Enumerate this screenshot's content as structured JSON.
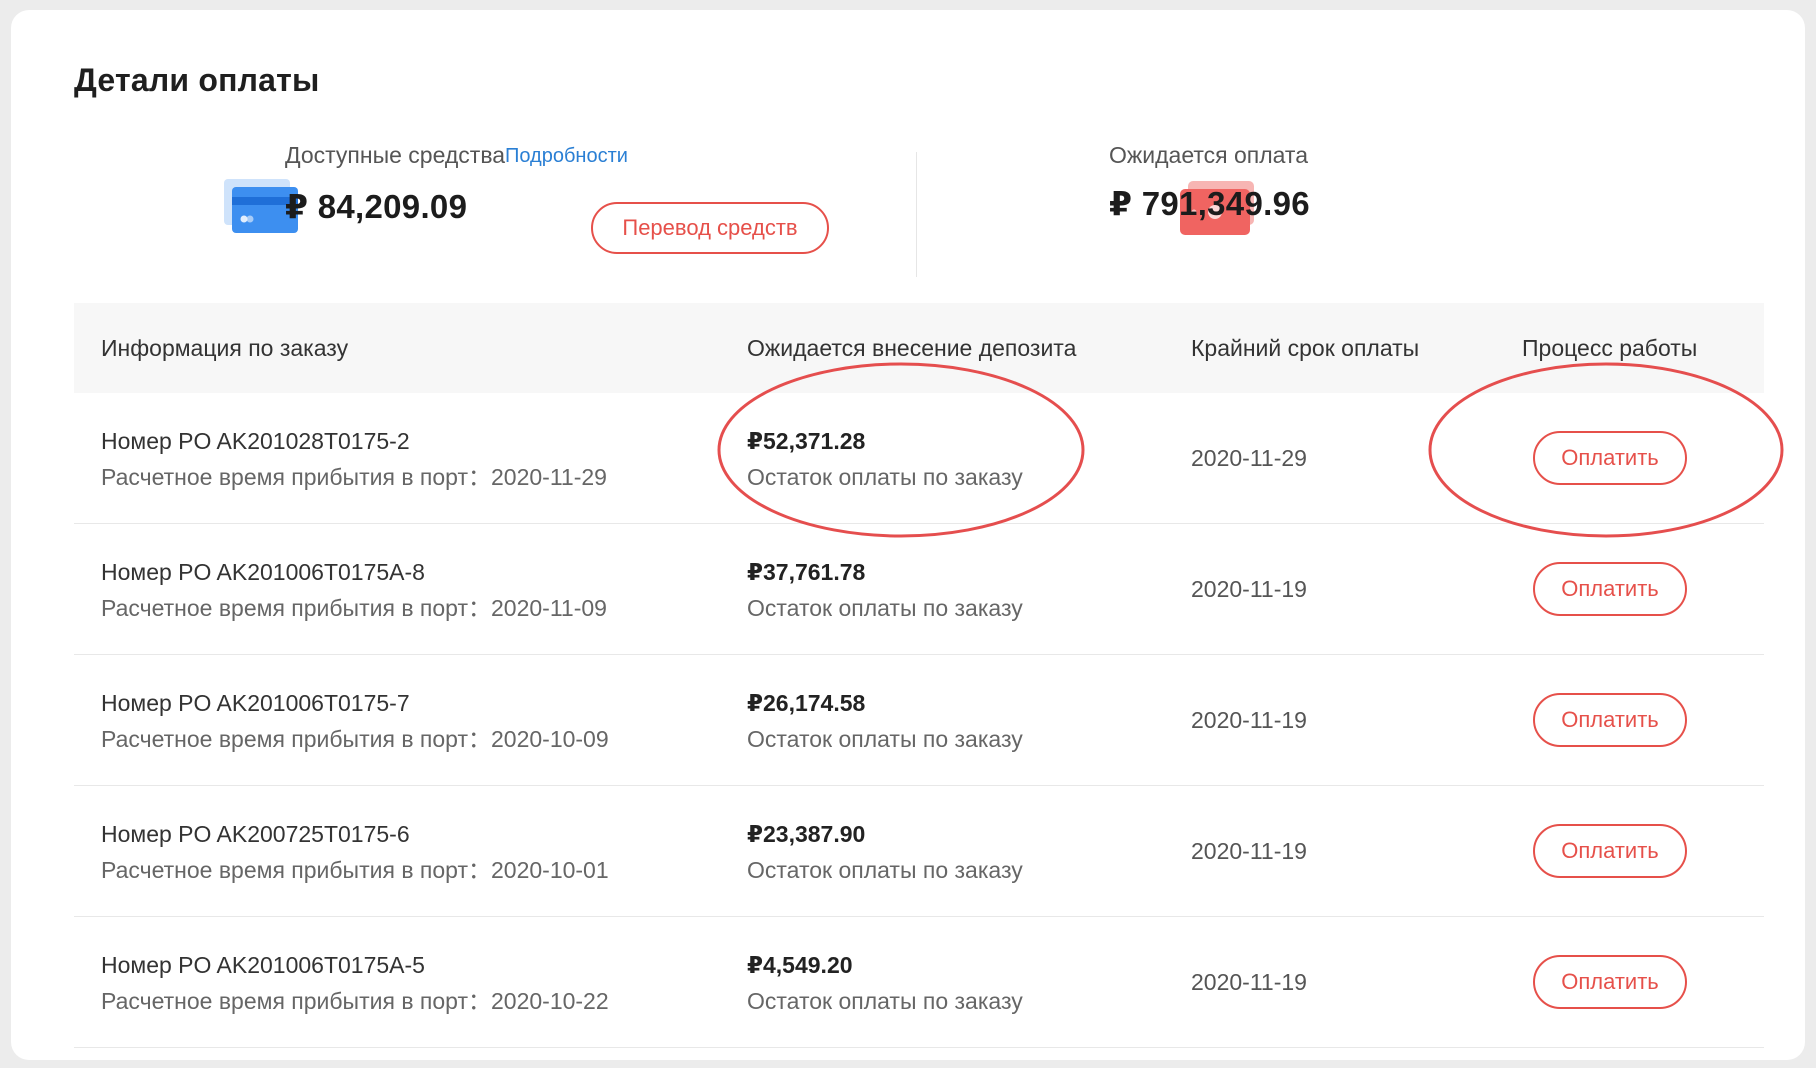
{
  "page_title": "Детали оплаты",
  "summary": {
    "available_label": "Доступные средства",
    "details_link": "Подробности",
    "available_amount": "₽ 84,209.09",
    "transfer_button": "Перевод средств",
    "expected_label": "Ожидается оплата",
    "expected_amount": "₽ 791,349.96"
  },
  "table": {
    "headers": {
      "order_info": "Информация по заказу",
      "deposit": "Ожидается внесение депозита",
      "deadline": "Крайний срок оплаты",
      "process": "Процесс работы"
    },
    "rows": [
      {
        "order_no": "Номер PO AK201028T0175-2",
        "eta": "Расчетное время прибытия в порт：2020-11-29",
        "amount": "₽52,371.28",
        "amount_desc": "Остаток оплаты по заказу",
        "deadline": "2020-11-29",
        "action": "Оплатить"
      },
      {
        "order_no": "Номер PO AK201006T0175A-8",
        "eta": "Расчетное время прибытия в порт：2020-11-09",
        "amount": "₽37,761.78",
        "amount_desc": "Остаток оплаты по заказу",
        "deadline": "2020-11-19",
        "action": "Оплатить"
      },
      {
        "order_no": "Номер PO AK201006T0175-7",
        "eta": "Расчетное время прибытия в порт：2020-10-09",
        "amount": "₽26,174.58",
        "amount_desc": "Остаток оплаты по заказу",
        "deadline": "2020-11-19",
        "action": "Оплатить"
      },
      {
        "order_no": "Номер PO AK200725T0175-6",
        "eta": "Расчетное время прибытия в порт：2020-10-01",
        "amount": "₽23,387.90",
        "amount_desc": "Остаток оплаты по заказу",
        "deadline": "2020-11-19",
        "action": "Оплатить"
      },
      {
        "order_no": "Номер PO AK201006T0175A-5",
        "eta": "Расчетное время прибытия в порт：2020-10-22",
        "amount": "₽4,549.20",
        "amount_desc": "Остаток оплаты по заказу",
        "deadline": "2020-11-19",
        "action": "Оплатить"
      }
    ]
  },
  "icons": {
    "available": "credit-card-icon",
    "expected": "cash-icon"
  },
  "colors": {
    "accent_red": "#e6504a",
    "link_blue": "#2a7fd4",
    "card_blue": "#3d8ff0",
    "annotation_red": "#e23b3b"
  }
}
